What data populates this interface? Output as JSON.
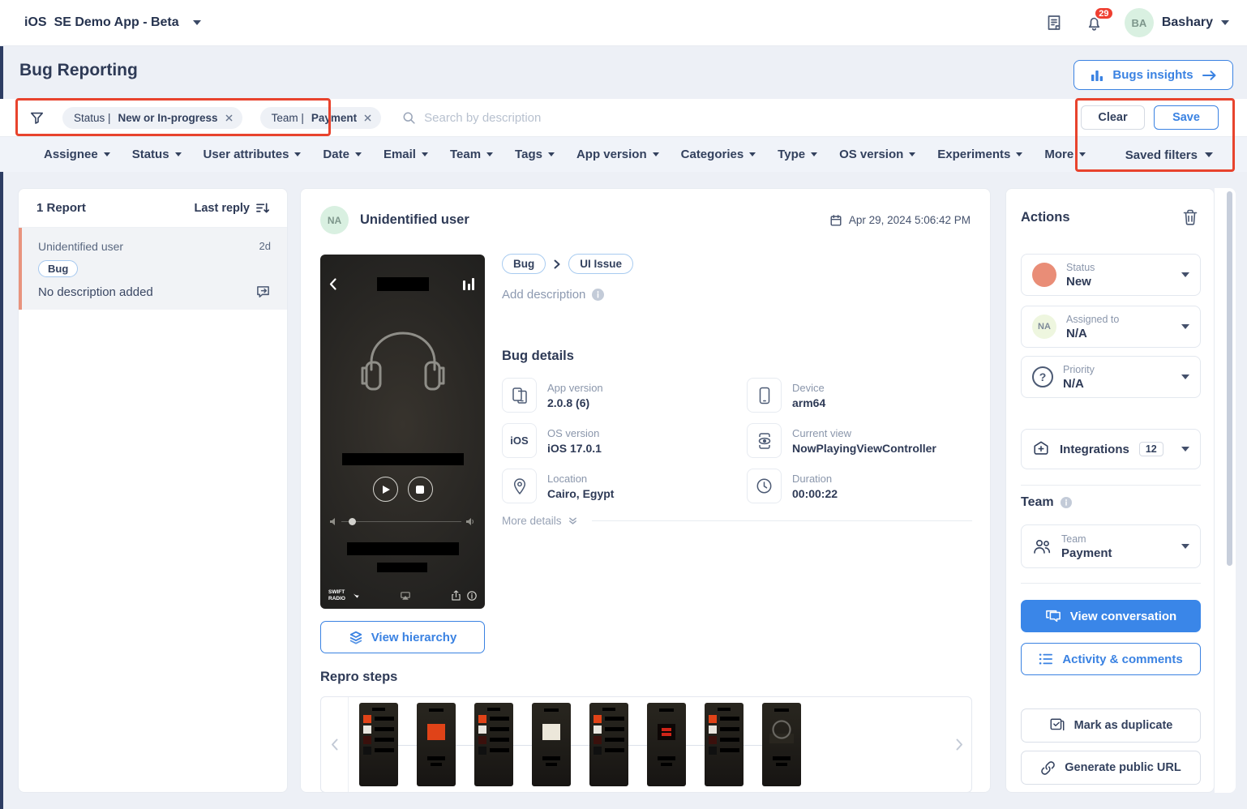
{
  "topbar": {
    "platform": "iOS",
    "app_name": "SE Demo App - Beta",
    "notification_count": "29",
    "avatar_initials": "BA",
    "user_name": "Bashary"
  },
  "header": {
    "title": "Bug Reporting",
    "insights_button": "Bugs insights"
  },
  "filter_bar": {
    "chips": [
      {
        "label": "Status |",
        "value": "New or In-progress"
      },
      {
        "label": "Team |",
        "value": "Payment"
      }
    ],
    "search_placeholder": "Search by description",
    "clear_button": "Clear",
    "save_button": "Save",
    "saved_filters": "Saved filters"
  },
  "filters": {
    "items": [
      "Assignee",
      "Status",
      "User attributes",
      "Date",
      "Email",
      "Team",
      "Tags",
      "App version",
      "Categories",
      "Type",
      "OS version",
      "Experiments",
      "More"
    ]
  },
  "reports_panel": {
    "count_label": "1 Report",
    "sort_label": "Last reply",
    "item": {
      "user": "Unidentified user",
      "age": "2d",
      "tag": "Bug",
      "description": "No description added"
    }
  },
  "report_detail": {
    "avatar_initials": "NA",
    "user": "Unidentified user",
    "timestamp": "Apr 29, 2024 5:06:42 PM",
    "category_chips": [
      "Bug",
      "UI Issue"
    ],
    "add_description": "Add description",
    "details_title": "Bug details",
    "os_icon_text": "iOS",
    "details": [
      {
        "label": "App version",
        "value": "2.0.8 (6)"
      },
      {
        "label": "Device",
        "value": "arm64"
      },
      {
        "label": "OS version",
        "value": "iOS 17.0.1"
      },
      {
        "label": "Current view",
        "value": "NowPlayingViewController"
      },
      {
        "label": "Location",
        "value": "Cairo, Egypt"
      },
      {
        "label": "Duration",
        "value": "00:00:22"
      }
    ],
    "more_details": "More details",
    "view_hierarchy_button": "View hierarchy",
    "repro_steps_title": "Repro steps",
    "screenshot": {
      "app_logo": "SWIFT RADIO"
    },
    "repro_thumbnails": [
      {
        "variant": "list"
      },
      {
        "variant": "player-red"
      },
      {
        "variant": "list"
      },
      {
        "variant": "player-logo"
      },
      {
        "variant": "list"
      },
      {
        "variant": "player-rock"
      },
      {
        "variant": "list"
      },
      {
        "variant": "player-headphones"
      }
    ]
  },
  "actions_panel": {
    "title": "Actions",
    "status": {
      "label": "Status",
      "value": "New"
    },
    "assigned": {
      "label": "Assigned to",
      "value": "N/A",
      "avatar_initials": "NA"
    },
    "priority": {
      "label": "Priority",
      "value": "N/A"
    },
    "integrations": {
      "label": "Integrations",
      "count": "12"
    },
    "team_section_title": "Team",
    "team": {
      "label": "Team",
      "value": "Payment"
    },
    "view_conversation_button": "View conversation",
    "activity_button": "Activity & comments",
    "duplicate_button": "Mark as duplicate",
    "public_url_button": "Generate public URL"
  },
  "colors": {
    "accent_blue": "#3a82e2",
    "annotation_red": "#e8432d",
    "badge_red": "#ef3e30",
    "status_salmon": "#e98d77",
    "selected_bar_orange": "#e8937e",
    "avatar_green": "#d9f0e1",
    "navy_text": "#2e3a56",
    "page_background": "#edf0f6"
  }
}
